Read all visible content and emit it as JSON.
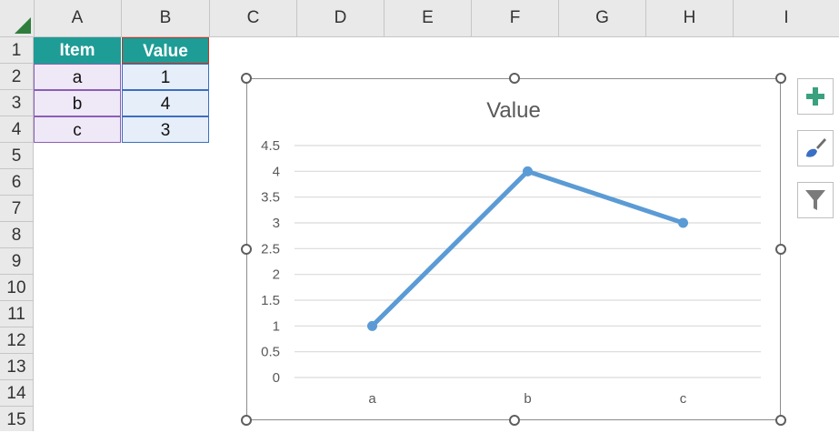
{
  "sheet": {
    "columns": [
      "A",
      "B",
      "C",
      "D",
      "E",
      "F",
      "G",
      "H",
      "I"
    ],
    "rows": [
      "1",
      "2",
      "3",
      "4",
      "5",
      "6",
      "7",
      "8",
      "9",
      "10",
      "11",
      "12",
      "13",
      "14",
      "15"
    ],
    "table": {
      "headers": [
        "Item",
        "Value"
      ],
      "rows": [
        [
          "a",
          "1"
        ],
        [
          "b",
          "4"
        ],
        [
          "c",
          "3"
        ]
      ]
    }
  },
  "chart_data": {
    "type": "line",
    "title": "Value",
    "categories": [
      "a",
      "b",
      "c"
    ],
    "series": [
      {
        "name": "Value",
        "values": [
          1,
          4,
          3
        ]
      }
    ],
    "y_ticks": [
      "0",
      "0.5",
      "1",
      "1.5",
      "2",
      "2.5",
      "3",
      "3.5",
      "4",
      "4.5"
    ],
    "ylim": [
      0,
      4.5
    ],
    "grid": true,
    "colors": {
      "line": "#5b9bd5",
      "grid": "#d9d9d9"
    }
  },
  "side_buttons": [
    "chart-elements-icon",
    "chart-styles-icon",
    "chart-filters-icon"
  ],
  "colors": {
    "header_fill": "#1e9c96",
    "accent": "#2f7d3c"
  }
}
